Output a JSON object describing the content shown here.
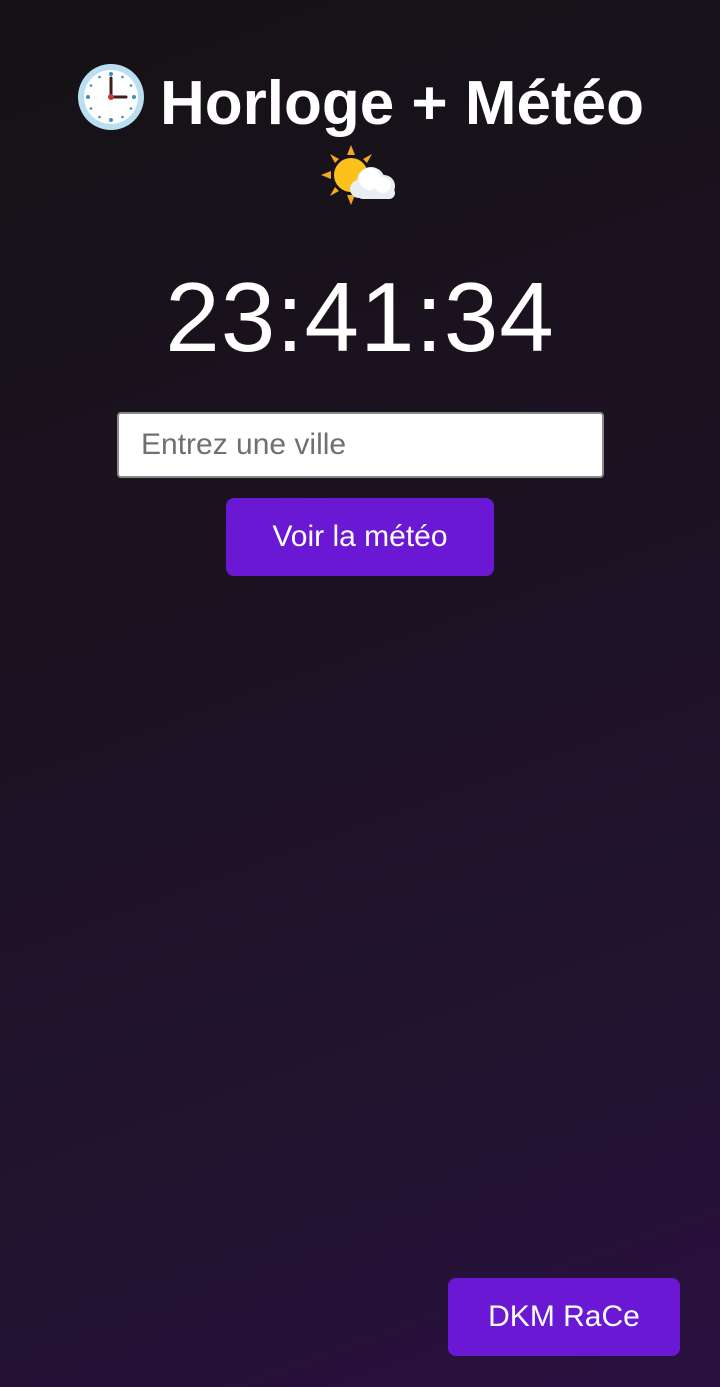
{
  "header": {
    "title": "Horloge + Météo",
    "leading_icon": "clock-three-icon",
    "trailing_icon": "sun-behind-cloud-icon"
  },
  "clock": {
    "time": "23:41:34"
  },
  "search": {
    "placeholder": "Entrez une ville",
    "value": ""
  },
  "actions": {
    "weather_button_label": "Voir la météo",
    "credit_button_label": "DKM RaCe"
  },
  "colors": {
    "accent": "#6a18d4",
    "background_start": "#141214",
    "background_end": "#2a1040",
    "text": "#ffffff"
  }
}
